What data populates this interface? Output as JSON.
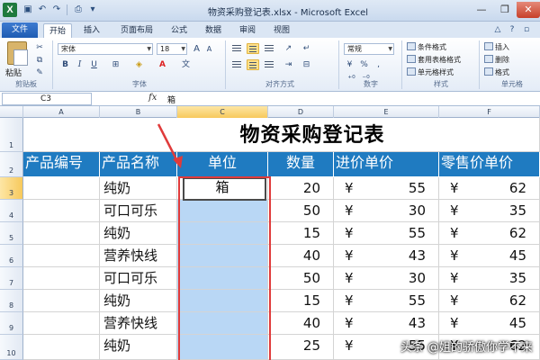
{
  "window": {
    "title": "物资采购登记表.xlsx - Microsoft Excel",
    "logo": "X"
  },
  "ribbon": {
    "file_tab": "文件",
    "tabs": [
      "开始",
      "插入",
      "页面布局",
      "公式",
      "数据",
      "审阅",
      "视图"
    ],
    "clipboard": {
      "paste": "粘贴",
      "label": "剪贴板"
    },
    "font": {
      "name": "宋体",
      "size": "18",
      "bold": "B",
      "italic": "I",
      "underline": "U",
      "grow": "A",
      "label": "字体"
    },
    "alignment": {
      "label": "对齐方式"
    },
    "number": {
      "format": "常规",
      "percent": "%",
      "comma": ",",
      "label": "数字"
    },
    "styles": {
      "items": [
        "条件格式",
        "套用表格格式",
        "单元格样式"
      ],
      "label": "样式"
    },
    "cells": {
      "items": [
        "插入",
        "删除",
        "格式"
      ],
      "label": "单元格"
    }
  },
  "formula_bar": {
    "name_box": "C3",
    "fx": "fx",
    "value": "箱"
  },
  "grid": {
    "columns": [
      "A",
      "B",
      "C",
      "D",
      "E",
      "F"
    ],
    "rows": [
      "1",
      "2",
      "3",
      "4",
      "5",
      "6",
      "7",
      "8",
      "9",
      "10"
    ],
    "sheet_title": "物资采购登记表",
    "headers": [
      "产品编号",
      "产品名称",
      "单位",
      "数量",
      "进价单价",
      "零售价单价"
    ],
    "currency_symbol": "¥",
    "data_rows": [
      {
        "name": "纯奶",
        "unit": "箱",
        "qty": "20",
        "cost": "55",
        "retail": "62"
      },
      {
        "name": "可口可乐",
        "unit": "",
        "qty": "50",
        "cost": "30",
        "retail": "35"
      },
      {
        "name": "纯奶",
        "unit": "",
        "qty": "15",
        "cost": "55",
        "retail": "62"
      },
      {
        "name": "营养快线",
        "unit": "",
        "qty": "40",
        "cost": "43",
        "retail": "45"
      },
      {
        "name": "可口可乐",
        "unit": "",
        "qty": "50",
        "cost": "30",
        "retail": "35"
      },
      {
        "name": "纯奶",
        "unit": "",
        "qty": "15",
        "cost": "55",
        "retail": "62"
      },
      {
        "name": "营养快线",
        "unit": "",
        "qty": "40",
        "cost": "43",
        "retail": "45"
      },
      {
        "name": "纯奶",
        "unit": "",
        "qty": "25",
        "cost": "55",
        "retail": "62"
      }
    ]
  },
  "watermark": "头条 @姐的骄傲你学不来",
  "colors": {
    "header_blue": "#1f7bc1",
    "selection_blue": "#b9d7f5",
    "annotation_red": "#e03b3b"
  }
}
